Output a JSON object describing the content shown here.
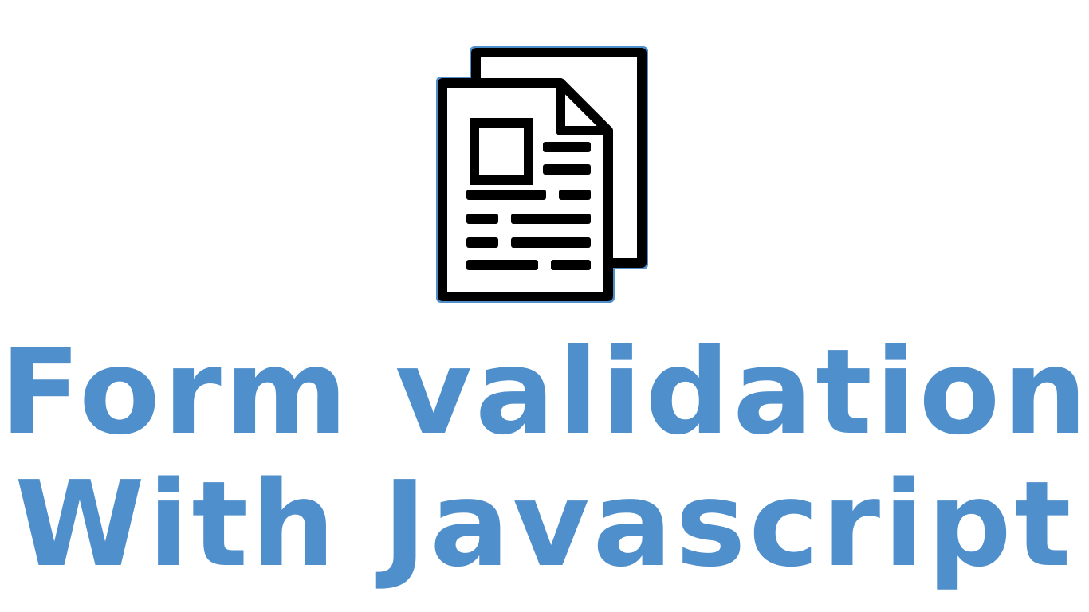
{
  "icon": {
    "name": "document-copy-icon"
  },
  "title": {
    "line1": "Form validation",
    "line2": "With Javascript"
  },
  "colors": {
    "title": "#4f8fcc",
    "icon_outline": "#000000",
    "icon_glow": "#4f8fcc",
    "background": "#ffffff"
  }
}
